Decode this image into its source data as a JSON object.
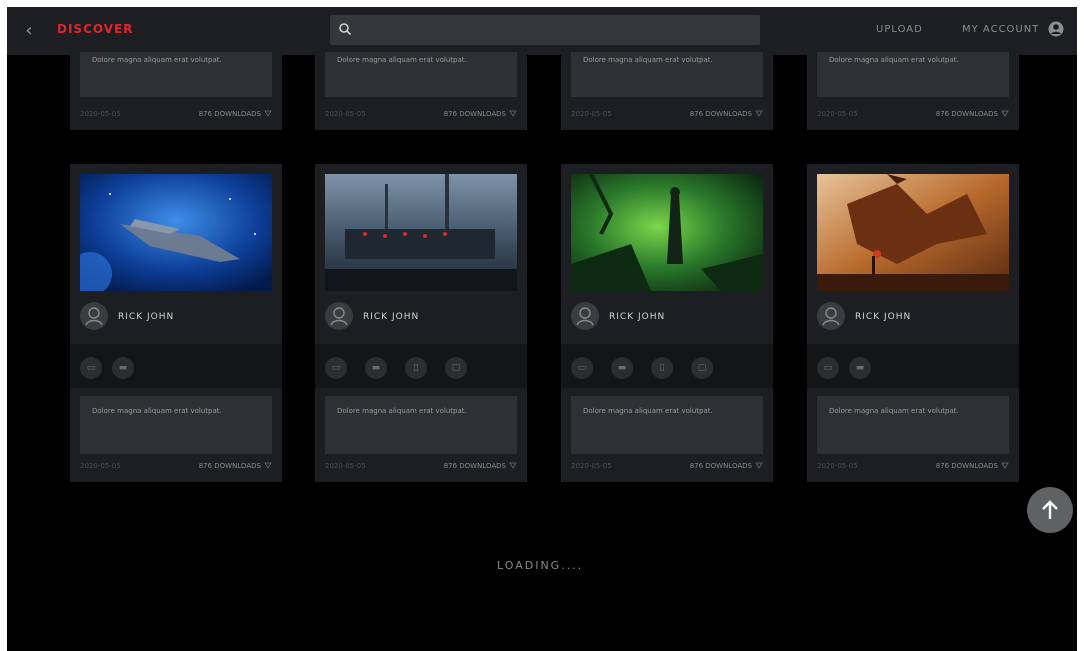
{
  "header": {
    "brand": "DISCOVER",
    "upload": "UPLOAD",
    "account": "MY ACCOUNT"
  },
  "top_cards": [
    {
      "desc": "Dolore magna aliquam erat volutpat.",
      "date": "2020-05-05",
      "downloads": "876 DOWNLOADS"
    },
    {
      "desc": "Dolore magna aliquam erat volutpat.",
      "date": "2020-05-05",
      "downloads": "876 DOWNLOADS"
    },
    {
      "desc": "Dolore magna aliquam erat volutpat.",
      "date": "2020-05-05",
      "downloads": "876 DOWNLOADS"
    },
    {
      "desc": "Dolore magna aliquam erat volutpat.",
      "date": "2020-05-05",
      "downloads": "876 DOWNLOADS"
    }
  ],
  "cards": [
    {
      "user": "RICK JOHN",
      "desc": "Dolore magna aliquam erat volutpat.",
      "date": "2020-05-05",
      "downloads": "876 DOWNLOADS",
      "thumb": "spaceship-scene"
    },
    {
      "user": "RICK JOHN",
      "desc": "Dolore magna aliquam erat volutpat.",
      "date": "2020-05-05",
      "downloads": "876 DOWNLOADS",
      "thumb": "soldiers-in-fog-scene"
    },
    {
      "user": "RICK JOHN",
      "desc": "Dolore magna aliquam erat volutpat.",
      "date": "2020-05-05",
      "downloads": "876 DOWNLOADS",
      "thumb": "green-forest-figure-scene"
    },
    {
      "user": "RICK JOHN",
      "desc": "Dolore magna aliquam erat volutpat.",
      "date": "2020-05-05",
      "downloads": "876 DOWNLOADS",
      "thumb": "dragon-scene"
    }
  ],
  "status": {
    "loading": "LOADING...."
  },
  "colors": {
    "brand": "#e0262c",
    "background": "#000000",
    "card": "#1c1e21",
    "topbar": "#1d1e21"
  },
  "icons": [
    "chevron-left-icon",
    "search-icon",
    "user-icon",
    "download-icon",
    "arrow-up-icon"
  ]
}
